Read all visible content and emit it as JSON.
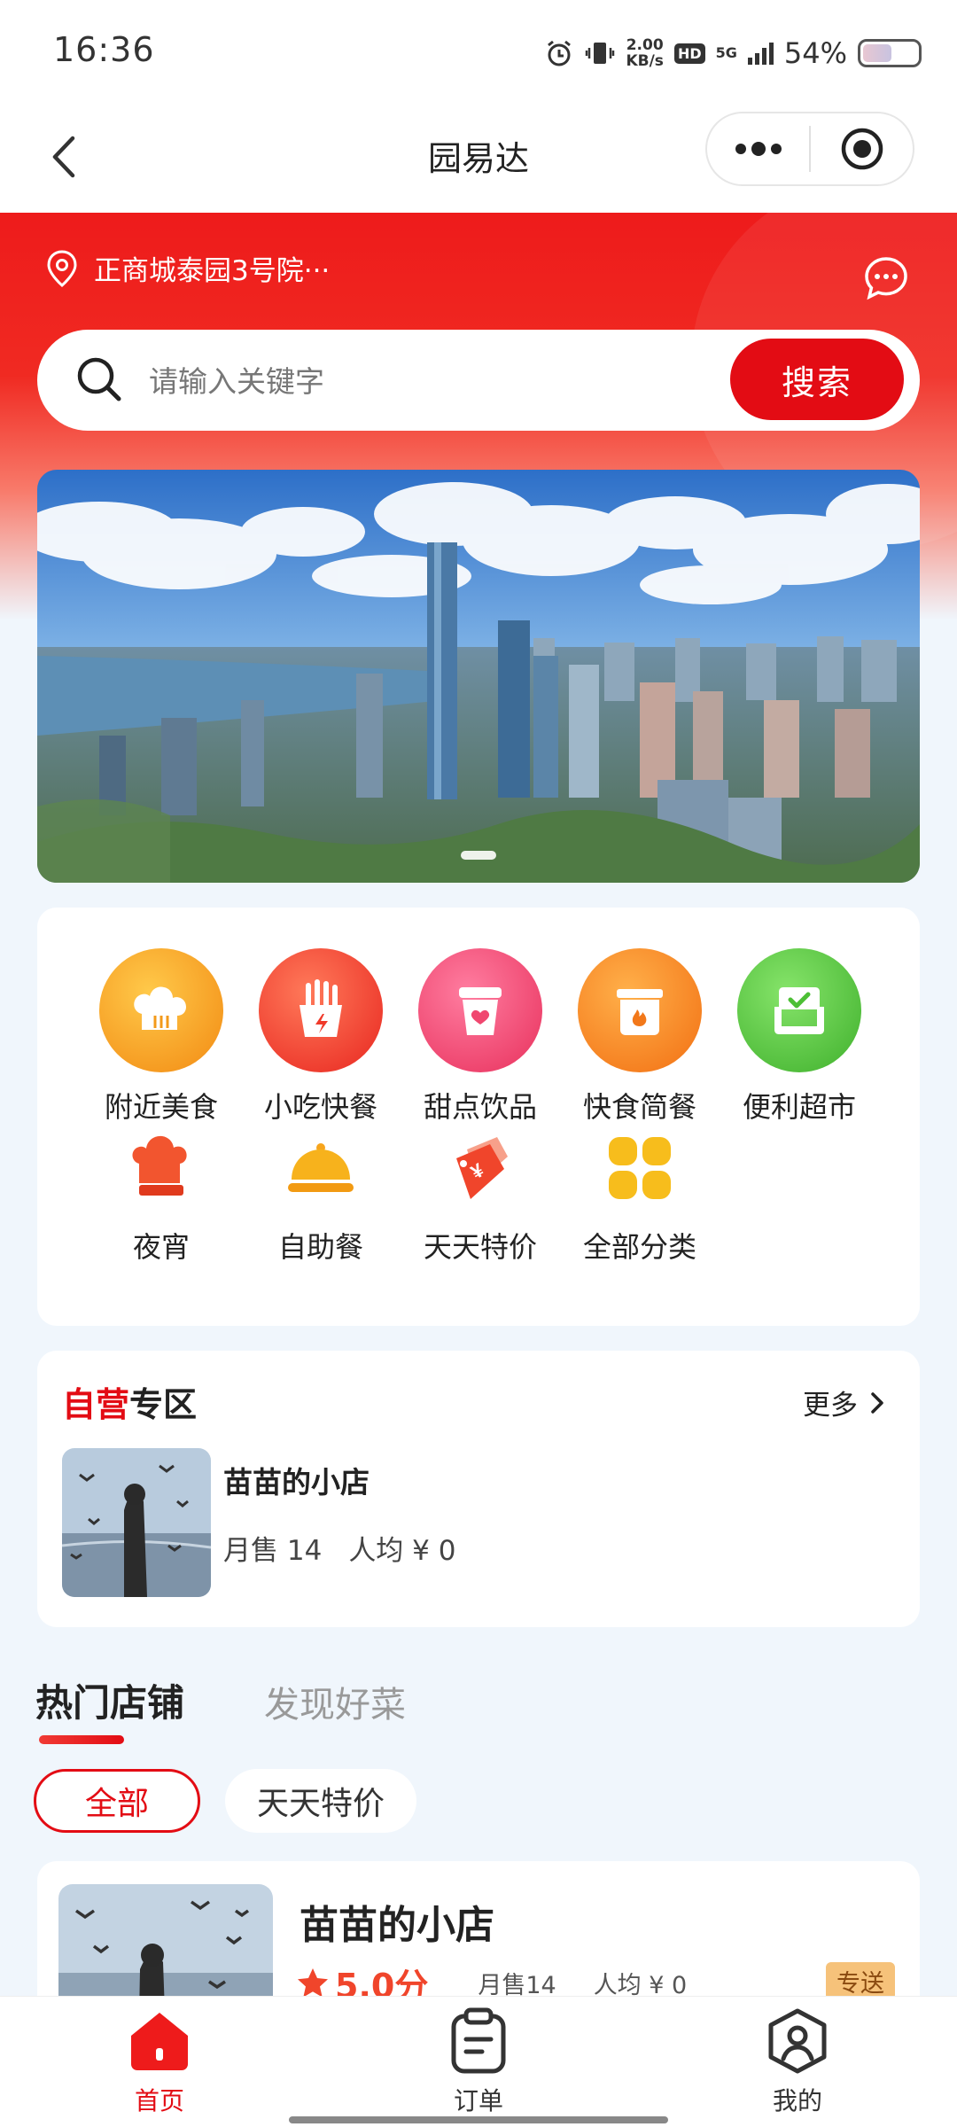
{
  "status_bar": {
    "time": "16:36",
    "net_speed_value": "2.00",
    "net_speed_unit": "KB/s",
    "hd_label": "HD",
    "network_label": "5G",
    "battery_percent": "54%",
    "battery_level": 0.54
  },
  "nav": {
    "title": "园易达"
  },
  "header": {
    "location": "正商城泰园3号院···",
    "search": {
      "placeholder": "请输入关键字",
      "button_label": "搜索"
    }
  },
  "banner": {
    "slide_count": 1,
    "active_slide": 1
  },
  "categories": [
    {
      "label": "附近美食",
      "icon": "chef-hat-icon",
      "color": "#f7a21b"
    },
    {
      "label": "小吃快餐",
      "icon": "fries-icon",
      "color": "#f2452c"
    },
    {
      "label": "甜点饮品",
      "icon": "drink-cup-icon",
      "color": "#f3426a"
    },
    {
      "label": "快食简餐",
      "icon": "food-box-icon",
      "color": "#f6861f"
    },
    {
      "label": "便利超市",
      "icon": "store-chair-icon",
      "color": "#5cc843"
    },
    {
      "label": "夜宵",
      "icon": "night-snack-icon",
      "color": "#f2552f"
    },
    {
      "label": "自助餐",
      "icon": "buffet-dome-icon",
      "color": "#f7b21c"
    },
    {
      "label": "天天特价",
      "icon": "price-tag-icon",
      "color": "#f2452c"
    },
    {
      "label": "全部分类",
      "icon": "grid-icon",
      "color": "#f7bd1c"
    }
  ],
  "self_operated": {
    "title_highlight": "自营",
    "title_rest": "专区",
    "more_label": "更多",
    "shop": {
      "name": "苗苗的小店",
      "monthly_sales": "月售 14",
      "avg_price": "人均 ¥ 0"
    }
  },
  "hot_section": {
    "tabs": [
      {
        "label": "热门店铺",
        "active": true
      },
      {
        "label": "发现好菜",
        "active": false
      }
    ],
    "chips": [
      {
        "label": "全部",
        "active": true
      },
      {
        "label": "天天特价",
        "active": false
      }
    ],
    "shop": {
      "name": "苗苗的小店",
      "rating": "5.0分",
      "monthly_sales": "月售14",
      "avg_price": "人均 ¥ 0",
      "tag": "专送"
    }
  },
  "tabbar": {
    "items": [
      {
        "label": "首页",
        "icon": "home-icon",
        "active": true
      },
      {
        "label": "订单",
        "icon": "order-clipboard-icon",
        "active": false
      },
      {
        "label": "我的",
        "icon": "profile-icon",
        "active": false
      }
    ]
  },
  "colors": {
    "brand_red": "#e30c14",
    "header_red": "#ee1b1b",
    "page_bg": "#f0f6fc",
    "rating_orange": "#f0452b"
  }
}
